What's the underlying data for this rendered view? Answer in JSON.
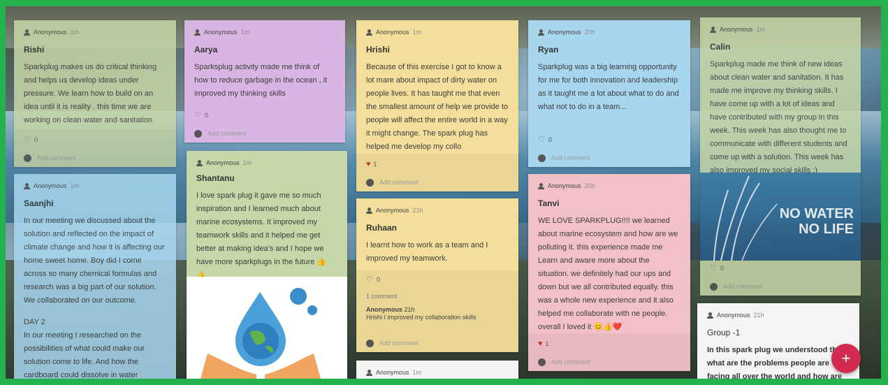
{
  "cards": [
    {
      "author": "Anonymous",
      "time": "1m",
      "title": "Rishi",
      "body": "Sparkplug makes us do critical thinking and helps us develop ideas under pressure. We learn how to build on an idea until it is reality . this time we are working on clean water and sanitation",
      "likes": "0",
      "add_comment": "Add comment"
    },
    {
      "author": "Anonymous",
      "time": "1m",
      "title": "Saanjhi",
      "body": "In our meeting we discussed about the solution and reflected on the impact of climate change and how it is affecting our home sweet home. Boy did I come across so many chemical formulas and research was a big part of our solution. We collaborated on our outcome.",
      "body2_heading": "DAY 2",
      "body2": "In our meeting I researched on the possibilities of what could make our solution come to life. And how the cardboard could dissolve in water"
    },
    {
      "author": "Anonymous",
      "time": "1m",
      "title": "Aarya",
      "body": "Sparksplug activity made me think of how to reduce garbage in the ocean , it improved my thinking skills",
      "likes": "0",
      "add_comment": "Add comment"
    },
    {
      "author": "Anonymous",
      "time": "1m",
      "title": "Shantanu",
      "body": "I love spark plug it gave me so much inspiration and I learned much about marine ecosystems. It improved my teamwork skills and it helped me get better at making idea's and I hope we have more sparkplugs in the future 👍 👍"
    },
    {
      "author": "Anonymous",
      "time": "1m",
      "title": "Hrishi",
      "body": "Because of this exercise I got to know a lot mare about impact of dirty water on people lives. It has taught me that even the smallest amount of help we provide to people will affect the entire world in a way it might change. The spark plug has helped me develop my collo",
      "likes": "1",
      "add_comment": "Add comment"
    },
    {
      "author": "Anonymous",
      "time": "21h",
      "title": "Ruhaan",
      "body": "I learnt how to work as a team and I improved my teamwork.",
      "likes": "0",
      "comments_count": "1 comment",
      "comment_author": "Anonymous",
      "comment_time": "21h",
      "comment_text": "Hrishi I improved my collaboration skills",
      "add_comment": "Add comment"
    },
    {
      "author": "Anonymous",
      "time": "1m"
    },
    {
      "author": "Anonymous",
      "time": "20h",
      "title": "Ryan",
      "body": "Sparkplug was a big learning opportunity for me for both innovation and leadership as it taught me a lot about what to do and what not to do in a team...",
      "likes": "0",
      "add_comment": "Add comment"
    },
    {
      "author": "Anonymous",
      "time": "20h",
      "title": "Tanvi",
      "body": "WE LOVE SPARKPLUG!!!! we learned about marine ecosystem and how are we polluting it. this experience made me Learn and aware more about the situation. we definitely had our ups and down but we all contributed equally. this was a whole new experience and it also helped me collaborate with ne people. overall I loved it 😊👍❤️",
      "likes": "1",
      "add_comment": "Add comment"
    },
    {
      "author": "Anonymous",
      "time": "1m",
      "title": "Calin",
      "body": "Sparkplug made me think of new ideas about clean water and sanitation. It has made me improve my thinking skills. I have come up with a lot of ideas and have contributed with my group in this week. This week has also thought me to communicate with different students and come up with a solution. This week has also improved my social skills :)",
      "poster_line1": "NO WATER",
      "poster_line2": "NO LIFE",
      "likes": "0",
      "add_comment": "Add comment"
    },
    {
      "author": "Anonymous",
      "time": "21h",
      "title": "Group -1",
      "body": "In this spark plug we understood that what are the problems people are facing all over the world and how are"
    }
  ],
  "fab_label": "+"
}
